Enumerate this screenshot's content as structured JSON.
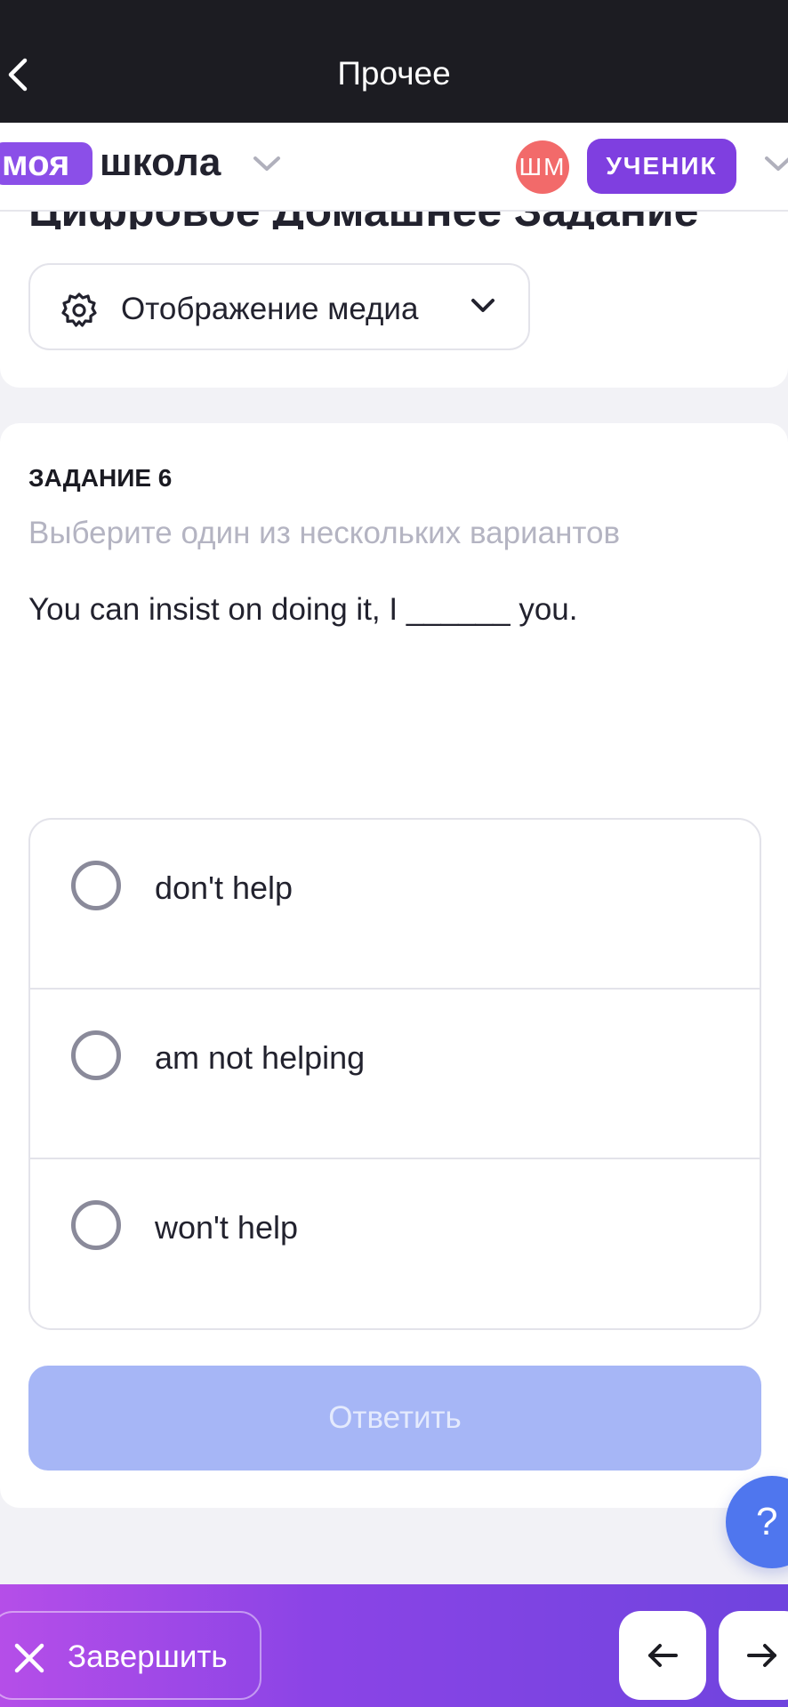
{
  "topbar": {
    "title": "Прочее"
  },
  "header": {
    "logo_pill": "моя",
    "logo_text": "школа",
    "avatar_initials": "ШМ",
    "role": "УЧЕНИК"
  },
  "page": {
    "title": "Цифровое Домашнее Задание",
    "media_button": "Отображение медиа"
  },
  "task": {
    "label": "ЗАДАНИЕ 6",
    "hint": "Выберите один из нескольких вариантов",
    "question": "You can insist on doing it, I ______ you.",
    "options": [
      "don't help",
      "am not helping",
      "won't help"
    ],
    "answer_button": "Ответить"
  },
  "help": {
    "label": "?"
  },
  "bottombar": {
    "finish_label": "Завершить"
  },
  "colors": {
    "brand_purple": "#7f3fe0",
    "avatar_red": "#f26a6a",
    "answer_disabled": "#a6b6f6",
    "help_blue": "#4f76ee"
  }
}
